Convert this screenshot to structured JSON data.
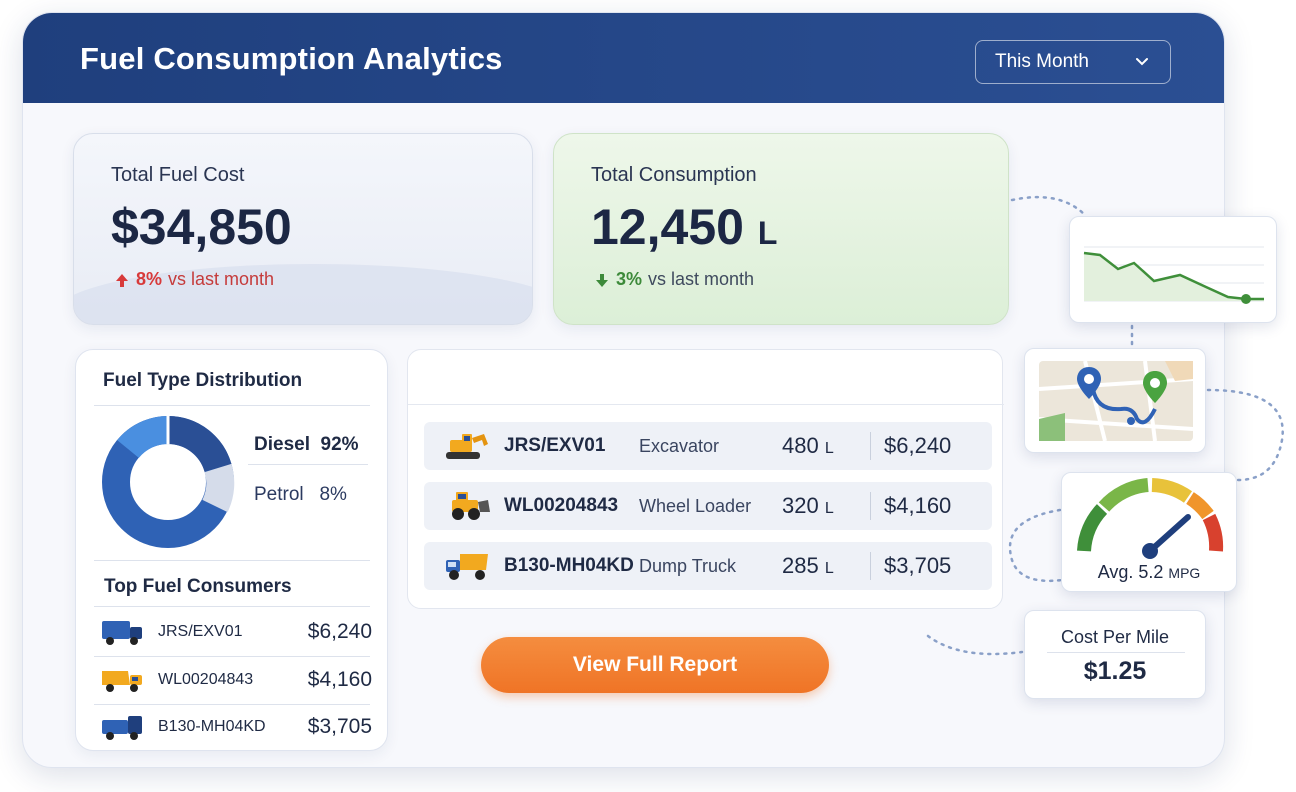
{
  "header": {
    "title": "Fuel Consumption Analytics",
    "period_selected": "This Month"
  },
  "kpis": {
    "cost": {
      "label": "Total Fuel Cost",
      "value": "$34,850",
      "delta": "8%",
      "delta_text": "vs last month",
      "direction": "up"
    },
    "consumption": {
      "label": "Total Consumption",
      "value": "12,450",
      "unit": "L",
      "delta": "3%",
      "delta_text": "vs last month",
      "direction": "down"
    }
  },
  "distribution": {
    "title": "Fuel Type Distribution",
    "diesel_label": "Diesel",
    "diesel_pct": "92%",
    "petrol_label": "Petrol",
    "petrol_pct": "8%"
  },
  "top_consumers": {
    "title": "Top Fuel Consumers",
    "rows": [
      {
        "name": "JRS/EXV01",
        "cost": "$6,240"
      },
      {
        "name": "WL00204843",
        "cost": "$4,160"
      },
      {
        "name": "B130-MH04KD",
        "cost": "$3,705"
      }
    ]
  },
  "equipment": [
    {
      "code": "JRS/EXV01",
      "type": "Excavator",
      "qty": "480",
      "unit": "L",
      "cost": "$6,240"
    },
    {
      "code": "WL00204843",
      "type": "Wheel Loader",
      "qty": "320",
      "unit": "L",
      "cost": "$4,160"
    },
    {
      "code": "B130-MH04KD",
      "type": "Dump Truck",
      "qty": "285",
      "unit": "L",
      "cost": "$3,705"
    }
  ],
  "actions": {
    "report_label": "View Full Report"
  },
  "widgets": {
    "gauge_label": "Avg. 5.2",
    "gauge_unit": "MPG",
    "cpm_title": "Cost Per Mile",
    "cpm_value": "$1.25"
  },
  "colors": {
    "header_bg": "#1f3f7d",
    "accent_orange": "#ef7426",
    "up_red": "#d83a3a",
    "down_green": "#3d8a3a",
    "donut_primary": "#2f62b5"
  },
  "icons": [
    "chevron-down-icon",
    "arrow-up-icon",
    "arrow-down-icon",
    "excavator-icon",
    "wheel-loader-icon",
    "dump-truck-icon",
    "truck-icon",
    "trend-line-icon",
    "map-route-icon",
    "gauge-icon"
  ]
}
